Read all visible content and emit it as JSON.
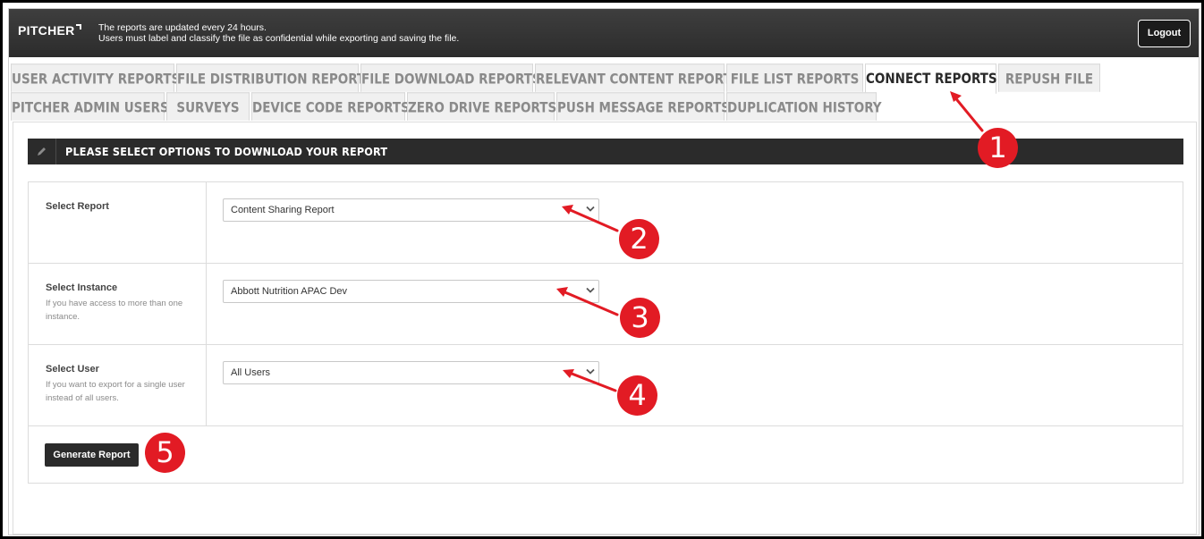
{
  "header": {
    "logo": "PITCHER",
    "notice_line1": "The reports are updated every 24 hours.",
    "notice_line2": "Users must label and classify the file as confidential while exporting and saving the file.",
    "logout_label": "Logout"
  },
  "tabs": {
    "row1": [
      {
        "label": "USER ACTIVITY REPORTS"
      },
      {
        "label": "FILE DISTRIBUTION REPORTS"
      },
      {
        "label": "FILE DOWNLOAD REPORTS"
      },
      {
        "label": "RELEVANT CONTENT REPORTS"
      },
      {
        "label": "FILE LIST REPORTS"
      },
      {
        "label": "CONNECT REPORTS",
        "active": true
      },
      {
        "label": "REPUSH FILE"
      }
    ],
    "row2": [
      {
        "label": "PITCHER ADMIN USERS"
      },
      {
        "label": "SURVEYS"
      },
      {
        "label": "DEVICE CODE REPORTS"
      },
      {
        "label": "ZERO DRIVE REPORTS"
      },
      {
        "label": "PUSH MESSAGE REPORTS"
      },
      {
        "label": "DUPLICATION HISTORY"
      }
    ]
  },
  "section": {
    "title": "PLEASE SELECT OPTIONS TO DOWNLOAD YOUR REPORT",
    "icon": "pencil-icon"
  },
  "form": {
    "report": {
      "label": "Select Report",
      "help": "",
      "value": "Content Sharing Report"
    },
    "instance": {
      "label": "Select Instance",
      "help": "If you have access to more than one instance.",
      "value": "Abbott Nutrition APAC Dev"
    },
    "user": {
      "label": "Select User",
      "help": "If you want to export for a single user instead of all users.",
      "value": "All Users"
    },
    "generate_label": "Generate Report"
  },
  "annotations": {
    "b1": "1",
    "b2": "2",
    "b3": "3",
    "b4": "4",
    "b5": "5",
    "color": "#e21b24"
  }
}
